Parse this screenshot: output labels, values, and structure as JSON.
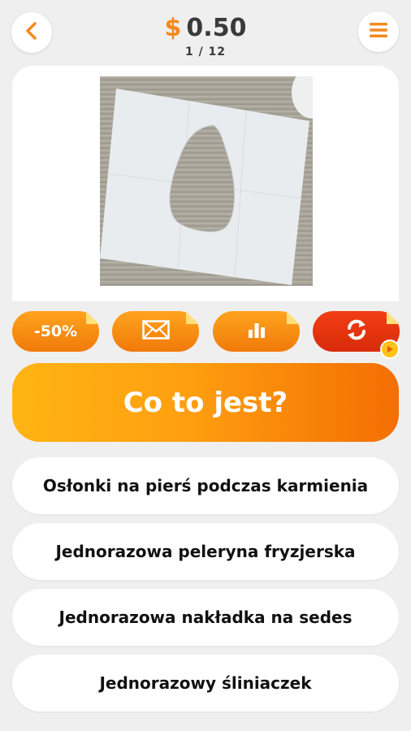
{
  "header": {
    "currency_symbol": "$",
    "balance": "0.50",
    "progress": "1 / 12",
    "back_icon": "chevron-left-icon",
    "menu_icon": "hamburger-icon"
  },
  "question_image": {
    "subject": "paper-sheet-with-oval-cutout"
  },
  "powerups": [
    {
      "label": "-50%",
      "icon": ""
    },
    {
      "label": "",
      "icon": "envelope-icon"
    },
    {
      "label": "",
      "icon": "bar-chart-icon"
    },
    {
      "label": "",
      "icon": "refresh-icon",
      "badge_icon": "play-icon"
    }
  ],
  "question": {
    "text": "Co to jest?"
  },
  "answers": [
    {
      "text": "Osłonki na pierś podczas karmienia"
    },
    {
      "text": "Jednorazowa peleryna fryzjerska"
    },
    {
      "text": "Jednorazowa nakładka na sedes"
    },
    {
      "text": "Jednorazowy śliniaczek"
    }
  ],
  "colors": {
    "accent_orange": "#f5891d",
    "background": "#efefef",
    "powerup_orange": "#f58a12",
    "powerup_red": "#e0330d"
  }
}
